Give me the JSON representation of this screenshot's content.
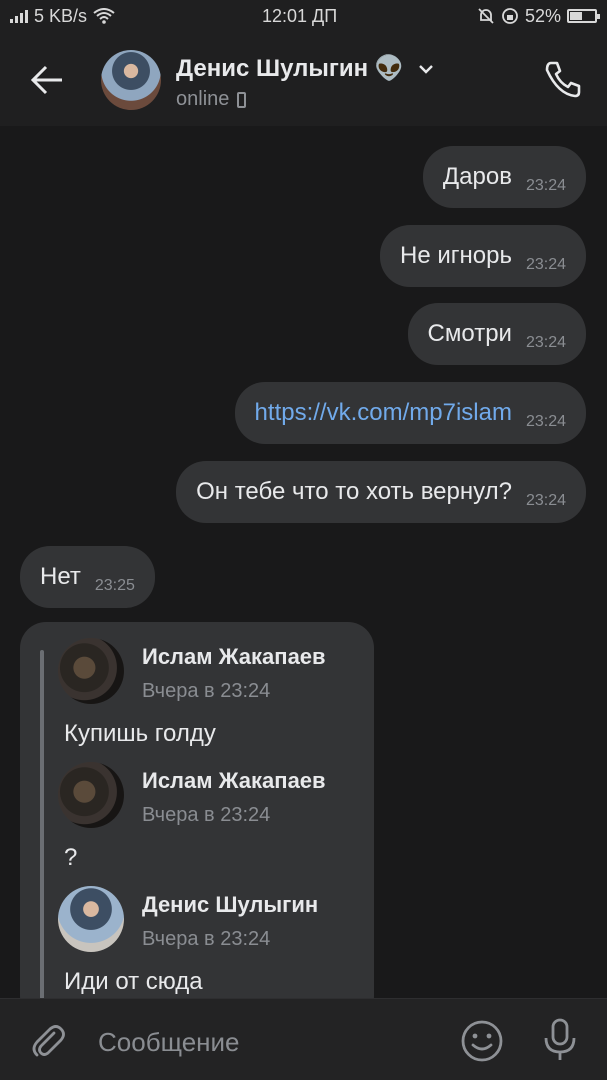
{
  "status_bar": {
    "net_speed": "5 KB/s",
    "time": "12:01 ДП",
    "battery_percent": "52%",
    "battery_level": 0.52
  },
  "header": {
    "contact_name": "Денис Шулыгин",
    "name_emoji": "👽",
    "presence": "online",
    "icons": [
      "back-arrow-icon",
      "chevron-down-icon",
      "phone-icon",
      "mobile-device-icon"
    ]
  },
  "messages": [
    {
      "text": "Даров",
      "time": "23:24",
      "side": "out"
    },
    {
      "text": "Не игнорь",
      "time": "23:24",
      "side": "out"
    },
    {
      "text": "Смотри",
      "time": "23:24",
      "side": "out"
    },
    {
      "text": "https://vk.com/mp7islam",
      "time": "23:24",
      "side": "out",
      "is_link": true
    },
    {
      "text": "Он тебе что то хоть вернул?",
      "time": "23:24",
      "side": "out"
    },
    {
      "text": "Нет",
      "time": "23:25",
      "side": "in"
    }
  ],
  "forwarded": [
    {
      "author": "Ислам Жакапаев",
      "time": "Вчера в 23:24",
      "text": "Купишь голду"
    },
    {
      "author": "Ислам Жакапаев",
      "time": "Вчера в 23:24",
      "text": "?"
    },
    {
      "author": "Денис Шулыгин",
      "time": "Вчера в 23:24",
      "text": "Иди от сюда"
    }
  ],
  "composer": {
    "placeholder": "Сообщение",
    "icons": [
      "paperclip-icon",
      "emoji-icon",
      "microphone-icon"
    ]
  }
}
